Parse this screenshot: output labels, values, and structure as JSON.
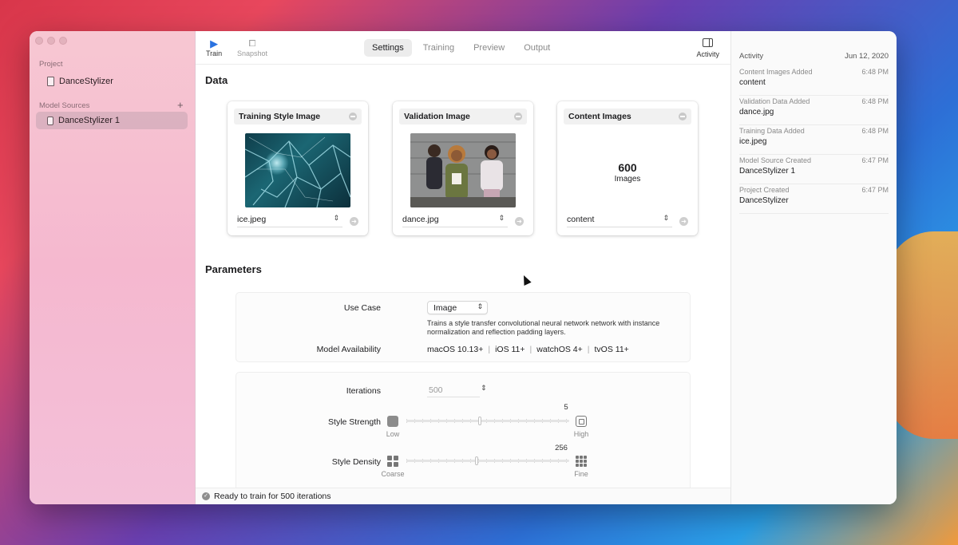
{
  "sidebar": {
    "project_section": "Project",
    "project_name": "DanceStylizer",
    "sources_section": "Model Sources",
    "add_icon": "plus-icon",
    "source_name": "DanceStylizer 1"
  },
  "toolbar": {
    "train_label": "Train",
    "snapshot_label": "Snapshot",
    "activity_label": "Activity",
    "tabs": [
      "Settings",
      "Training",
      "Preview",
      "Output"
    ],
    "active_tab": "Settings"
  },
  "data_section": {
    "title": "Data",
    "cards": [
      {
        "title": "Training Style Image",
        "file": "ice.jpeg"
      },
      {
        "title": "Validation Image",
        "file": "dance.jpg"
      },
      {
        "title": "Content Images",
        "count": "600",
        "count_label": "Images",
        "file": "content"
      }
    ]
  },
  "parameters": {
    "title": "Parameters",
    "use_case_label": "Use Case",
    "use_case_value": "Image",
    "use_case_description": "Trains a style transfer convolutional neural network network with instance normalization and reflection padding layers.",
    "availability_label": "Model Availability",
    "availability": [
      "macOS 10.13+",
      "iOS 11+",
      "watchOS 4+",
      "tvOS 11+"
    ],
    "iterations_label": "Iterations",
    "iterations_placeholder": "500",
    "style_strength": {
      "label": "Style Strength",
      "value": "5",
      "min_label": "Low",
      "max_label": "High",
      "fraction": 0.45
    },
    "style_density": {
      "label": "Style Density",
      "value": "256",
      "min_label": "Coarse",
      "max_label": "Fine",
      "fraction": 0.43
    }
  },
  "status": {
    "text": "Ready to train for 500 iterations"
  },
  "activity": {
    "header": "Activity",
    "date": "Jun 12, 2020",
    "items": [
      {
        "type": "Content Images Added",
        "name": "content",
        "time": "6:48 PM"
      },
      {
        "type": "Validation Data Added",
        "name": "dance.jpg",
        "time": "6:48 PM"
      },
      {
        "type": "Training Data Added",
        "name": "ice.jpeg",
        "time": "6:48 PM"
      },
      {
        "type": "Model Source Created",
        "name": "DanceStylizer 1",
        "time": "6:47 PM"
      },
      {
        "type": "Project Created",
        "name": "DanceStylizer",
        "time": "6:47 PM"
      }
    ]
  },
  "colors": {
    "accent": "#2a72e0",
    "sidebar": "#f5b8cf"
  }
}
